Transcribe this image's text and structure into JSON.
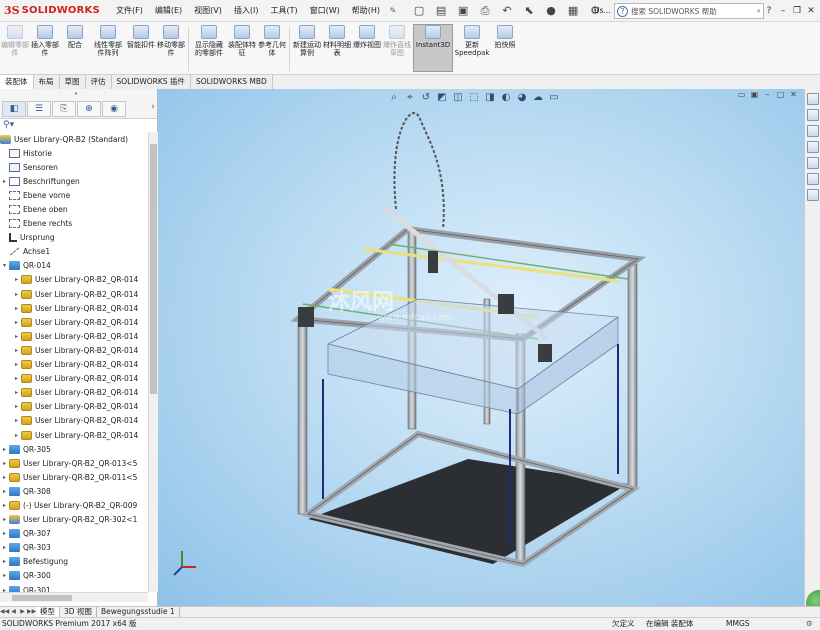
{
  "app": {
    "logo_ds": "3S",
    "logo_text": "SOLIDWORKS",
    "menu": [
      "文件(F)",
      "编辑(E)",
      "视图(V)",
      "插入(I)",
      "工具(T)",
      "窗口(W)",
      "帮助(H)"
    ],
    "search_placeholder": "搜索 SOLIDWORKS 帮助",
    "extra_label": "Us..."
  },
  "ribbon": {
    "buttons": [
      {
        "label": "编辑零部件",
        "dim": true
      },
      {
        "label": "插入零部件",
        "dim": false
      },
      {
        "label": "配合",
        "dim": false
      },
      {
        "label": "线性零部件阵列",
        "dim": false
      },
      {
        "label": "智能扣件",
        "dim": false
      },
      {
        "label": "移动零部件",
        "dim": false
      },
      {
        "label": "显示隐藏的零部件",
        "dim": false
      },
      {
        "label": "装配体特征",
        "dim": false
      },
      {
        "label": "参考几何体",
        "dim": false
      },
      {
        "label": "新建运动算例",
        "dim": false
      },
      {
        "label": "材料明细表",
        "dim": false
      },
      {
        "label": "爆炸视图",
        "dim": false
      },
      {
        "label": "爆炸直线草图",
        "dim": true
      },
      {
        "label": "Instant3D",
        "dim": false,
        "active": true
      },
      {
        "label": "更新 Speedpak",
        "dim": false
      },
      {
        "label": "拍快照",
        "dim": false
      }
    ]
  },
  "tabs": [
    "装配体",
    "布局",
    "草图",
    "评估",
    "SOLIDWORKS 插件",
    "SOLIDWORKS MBD"
  ],
  "tree": {
    "root": "User Library-QR-B2  (Standard)",
    "items": [
      {
        "label": "Historie",
        "icon": "hist",
        "arrow": ""
      },
      {
        "label": "Sensoren",
        "icon": "sensor",
        "arrow": ""
      },
      {
        "label": "Beschriftungen",
        "icon": "annot",
        "arrow": "▸"
      },
      {
        "label": "Ebene vorne",
        "icon": "plane",
        "arrow": ""
      },
      {
        "label": "Ebene oben",
        "icon": "plane",
        "arrow": ""
      },
      {
        "label": "Ebene rechts",
        "icon": "plane",
        "arrow": ""
      },
      {
        "label": "Ursprung",
        "icon": "origin",
        "arrow": ""
      },
      {
        "label": "Achse1",
        "icon": "axis",
        "arrow": ""
      },
      {
        "label": "QR-014",
        "icon": "folder",
        "arrow": "▾"
      },
      {
        "label": "User Library-QR-B2_QR-014",
        "icon": "asm",
        "arrow": "▸",
        "indent": 1
      },
      {
        "label": "User Library-QR-B2_QR-014",
        "icon": "asm",
        "arrow": "▸",
        "indent": 1
      },
      {
        "label": "User Library-QR-B2_QR-014",
        "icon": "asm",
        "arrow": "▸",
        "indent": 1
      },
      {
        "label": "User Library-QR-B2_QR-014",
        "icon": "asm",
        "arrow": "▸",
        "indent": 1
      },
      {
        "label": "User Library-QR-B2_QR-014",
        "icon": "asm",
        "arrow": "▸",
        "indent": 1
      },
      {
        "label": "User Library-QR-B2_QR-014",
        "icon": "asm",
        "arrow": "▸",
        "indent": 1
      },
      {
        "label": "User Library-QR-B2_QR-014",
        "icon": "asm",
        "arrow": "▸",
        "indent": 1
      },
      {
        "label": "User Library-QR-B2_QR-014",
        "icon": "asm",
        "arrow": "▸",
        "indent": 1
      },
      {
        "label": "User Library-QR-B2_QR-014",
        "icon": "asm",
        "arrow": "▸",
        "indent": 1
      },
      {
        "label": "User Library-QR-B2_QR-014",
        "icon": "asm",
        "arrow": "▸",
        "indent": 1
      },
      {
        "label": "User Library-QR-B2_QR-014",
        "icon": "asm",
        "arrow": "▸",
        "indent": 1
      },
      {
        "label": "User Library-QR-B2_QR-014",
        "icon": "asm",
        "arrow": "▸",
        "indent": 1
      },
      {
        "label": "QR-305",
        "icon": "folder",
        "arrow": "▸"
      },
      {
        "label": "User Library-QR-B2_QR-013<5",
        "icon": "asm",
        "arrow": "▸"
      },
      {
        "label": "User Library-QR-B2_QR-011<5",
        "icon": "asm",
        "arrow": "▸"
      },
      {
        "label": "QR-308",
        "icon": "folder",
        "arrow": "▸"
      },
      {
        "label": "(-) User Library-QR-B2_QR-009",
        "icon": "asm",
        "arrow": "▸"
      },
      {
        "label": "User Library-QR-B2_QR-302<1",
        "icon": "root",
        "arrow": "▸"
      },
      {
        "label": "QR-307",
        "icon": "folder",
        "arrow": "▸"
      },
      {
        "label": "QR-303",
        "icon": "folder",
        "arrow": "▸"
      },
      {
        "label": "Befestigung",
        "icon": "folder",
        "arrow": "▸"
      },
      {
        "label": "QR-300",
        "icon": "folder",
        "arrow": "▸"
      },
      {
        "label": "QR-301",
        "icon": "folder",
        "arrow": "▸"
      }
    ]
  },
  "viewport": {
    "watermark": "沐风网",
    "watermark_sub": "www.mfcad.com",
    "background_color": "#bcdcf3"
  },
  "bottom_tabs": [
    "模型",
    "3D 视图",
    "Bewegungsstudie 1"
  ],
  "status": {
    "left": "SOLIDWORKS Premium 2017 x64 版",
    "definition": "欠定义",
    "editing": "在编辑 装配体",
    "units": "MMGS"
  },
  "colors": {
    "brand_red": "#d0211c",
    "viewport_top": "#dff0fc",
    "viewport_edge": "#8fc2e8"
  }
}
